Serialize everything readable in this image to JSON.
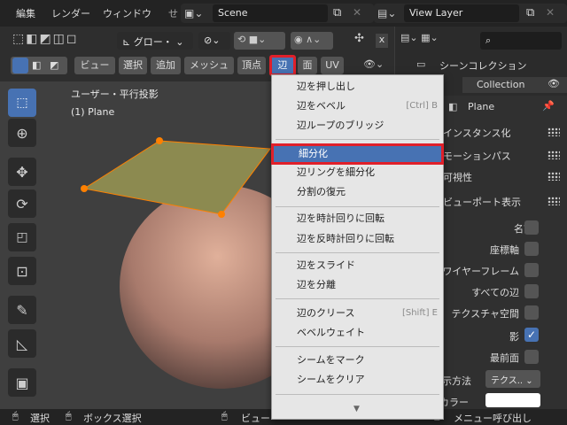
{
  "topbar": {
    "menus": [
      "編集",
      "レンダー",
      "ウィンドウ"
    ],
    "scene": "Scene",
    "view_layer": "View Layer"
  },
  "header": {
    "transform": "グロー・",
    "buttons": [
      "ビュー",
      "選択",
      "追加",
      "メッシュ",
      "頂点",
      "辺",
      "面",
      "UV"
    ],
    "active": "辺",
    "close": "x"
  },
  "viewport": {
    "view_name": "ユーザー・平行投影",
    "object_name": "(1) Plane"
  },
  "outliner": {
    "title": "シーンコレクション",
    "collection": "Collection"
  },
  "properties": {
    "object": "Plane",
    "sections": [
      "インスタンス化",
      "モーションパス",
      "可視性",
      "ビューポート表示"
    ],
    "rows": [
      {
        "label": "名前",
        "checked": false
      },
      {
        "label": "座標軸",
        "checked": false
      },
      {
        "label": "ワイヤーフレーム",
        "checked": false
      },
      {
        "label": "すべての辺",
        "checked": false
      },
      {
        "label": "テクスチャ空間",
        "checked": false
      },
      {
        "label": "影",
        "checked": true
      },
      {
        "label": "最前面",
        "checked": false
      }
    ],
    "display_label": "表示方法",
    "display_value": "テクス..",
    "color_label": "カラー"
  },
  "dropdown": {
    "items": [
      {
        "label": "辺を押し出し",
        "shortcut": ""
      },
      {
        "label": "辺をベベル",
        "shortcut": "[Ctrl] B"
      },
      {
        "label": "辺ループのブリッジ",
        "shortcut": ""
      },
      {
        "label": "細分化",
        "shortcut": "",
        "highlight": true
      },
      {
        "label": "辺リングを細分化",
        "shortcut": ""
      },
      {
        "label": "分割の復元",
        "shortcut": ""
      },
      {
        "label": "辺を時計回りに回転",
        "shortcut": ""
      },
      {
        "label": "辺を反時計回りに回転",
        "shortcut": ""
      },
      {
        "label": "辺をスライド",
        "shortcut": ""
      },
      {
        "label": "辺を分離",
        "shortcut": ""
      },
      {
        "label": "辺のクリース",
        "shortcut": "[Shift] E"
      },
      {
        "label": "ベベルウェイト",
        "shortcut": ""
      },
      {
        "label": "シームをマーク",
        "shortcut": ""
      },
      {
        "label": "シームをクリア",
        "shortcut": ""
      }
    ],
    "more": "▼"
  },
  "status": {
    "select": "選択",
    "box_select": "ボックス選択",
    "view": "ビュー",
    "menu": "メニュー呼び出し"
  },
  "colors": {
    "accent": "#4772b3",
    "highlight_border": "#e0202a",
    "check": "#4772b3",
    "vertex": "#ff8000",
    "plane": "#8c8a50"
  }
}
